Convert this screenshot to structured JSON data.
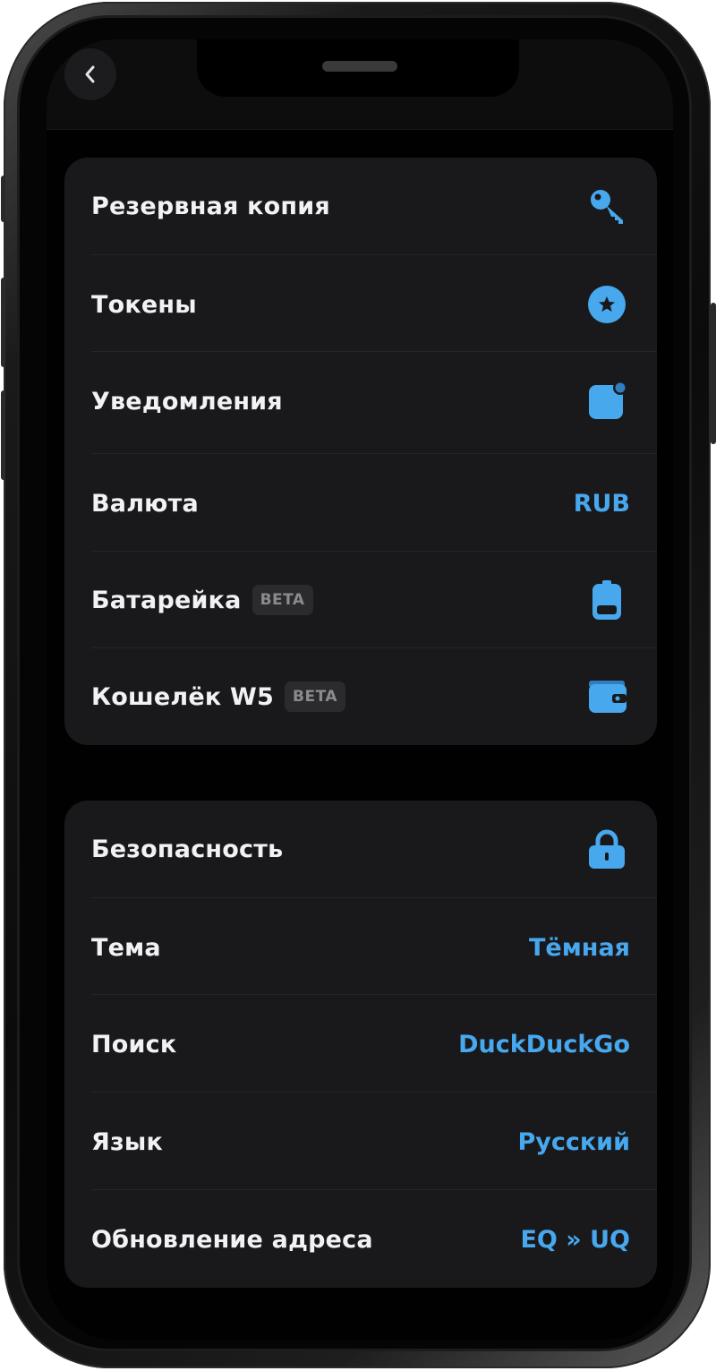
{
  "colors": {
    "accent": "#47a8ee",
    "card": "#19191b",
    "text": "#f2f2f4",
    "badge_bg": "#2b2b2e",
    "badge_text": "#8a8a8f"
  },
  "header": {
    "back_icon": "chevron-left-icon"
  },
  "section1": {
    "rows": [
      {
        "label": "Резервная копия",
        "icon": "key-icon"
      },
      {
        "label": "Токены",
        "icon": "star-circle-icon"
      },
      {
        "label": "Уведомления",
        "icon": "notification-icon"
      },
      {
        "label": "Валюта",
        "value": "RUB"
      },
      {
        "label": "Батарейка",
        "badge": "BETA",
        "icon": "battery-icon"
      },
      {
        "label": "Кошелёк W5",
        "badge": "BETA",
        "icon": "wallet-icon"
      }
    ]
  },
  "section2": {
    "rows": [
      {
        "label": "Безопасность",
        "icon": "lock-icon"
      },
      {
        "label": "Тема",
        "value": "Тёмная"
      },
      {
        "label": "Поиск",
        "value": "DuckDuckGo"
      },
      {
        "label": "Язык",
        "value": "Русский"
      },
      {
        "label": "Обновление адреса",
        "value": "EQ » UQ"
      }
    ]
  }
}
